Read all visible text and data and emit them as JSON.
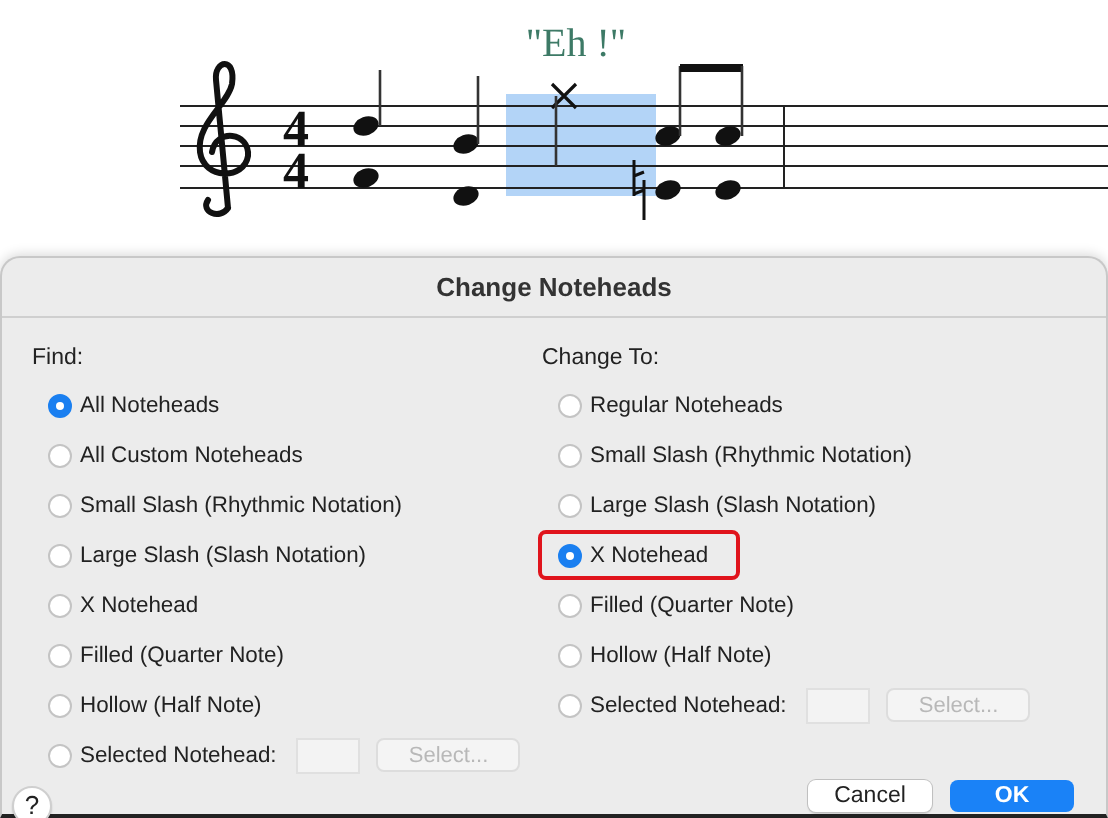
{
  "score": {
    "lyric": "\"Eh !\"",
    "time_signature": [
      "4",
      "4"
    ],
    "notes": [
      {
        "kind": "chord",
        "selected": false
      },
      {
        "kind": "chord",
        "selected": false
      },
      {
        "kind": "x-note",
        "selected": true
      },
      {
        "kind": "chord",
        "selected": false
      },
      {
        "kind": "chord",
        "selected": false
      }
    ]
  },
  "dialog": {
    "title": "Change Noteheads",
    "find": {
      "label": "Find:",
      "options": [
        {
          "kind": "radio",
          "label": "All Noteheads",
          "selected": true
        },
        {
          "kind": "radio",
          "label": "All Custom Noteheads",
          "selected": false
        },
        {
          "kind": "radio",
          "label": "Small Slash (Rhythmic Notation)",
          "selected": false
        },
        {
          "kind": "radio",
          "label": "Large Slash (Slash Notation)",
          "selected": false
        },
        {
          "kind": "radio",
          "label": "X Notehead",
          "selected": false
        },
        {
          "kind": "radio",
          "label": "Filled (Quarter Note)",
          "selected": false
        },
        {
          "kind": "radio",
          "label": "Hollow (Half Note)",
          "selected": false
        },
        {
          "kind": "picker",
          "label": "Selected Notehead:",
          "selected": false,
          "button": {
            "label": "Select...",
            "disabled": true
          }
        }
      ]
    },
    "change_to": {
      "label": "Change To:",
      "options": [
        {
          "kind": "radio",
          "label": "Regular Noteheads",
          "selected": false
        },
        {
          "kind": "radio",
          "label": "Small Slash (Rhythmic Notation)",
          "selected": false
        },
        {
          "kind": "radio",
          "label": "Large Slash (Slash Notation)",
          "selected": false
        },
        {
          "kind": "radio",
          "label": "X Notehead",
          "selected": true,
          "highlighted": true
        },
        {
          "kind": "radio",
          "label": "Filled (Quarter Note)",
          "selected": false
        },
        {
          "kind": "radio",
          "label": "Hollow (Half Note)",
          "selected": false
        },
        {
          "kind": "picker",
          "label": "Selected Notehead:",
          "selected": false,
          "button": {
            "label": "Select...",
            "disabled": true
          }
        }
      ]
    },
    "help": "?",
    "buttons": [
      {
        "kind": "secondary",
        "label": "Cancel"
      },
      {
        "kind": "primary",
        "label": "OK"
      }
    ]
  }
}
